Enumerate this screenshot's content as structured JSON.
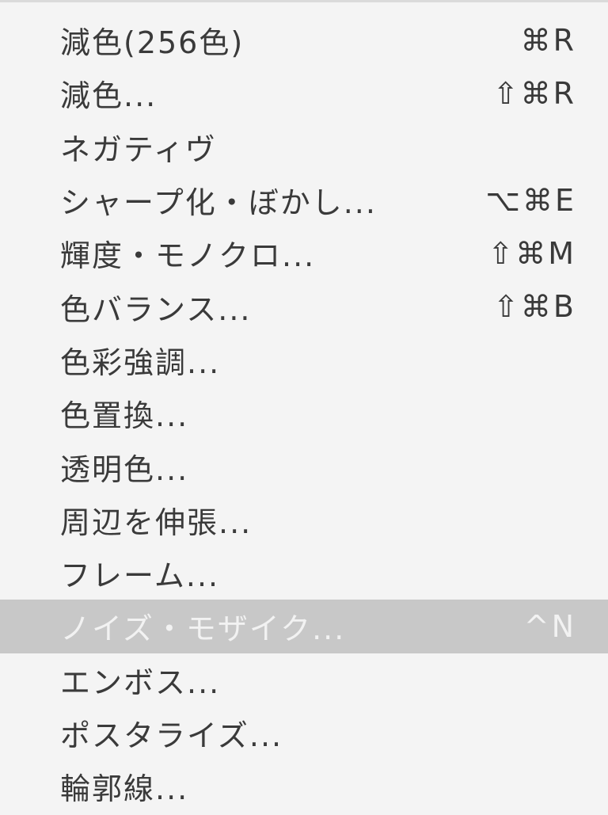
{
  "menu": {
    "items": [
      {
        "label": "減色(256色)",
        "shortcut": "⌘R",
        "highlighted": false
      },
      {
        "label": "減色...",
        "shortcut": "⇧⌘R",
        "highlighted": false
      },
      {
        "label": "ネガティヴ",
        "shortcut": "",
        "highlighted": false
      },
      {
        "label": "シャープ化・ぼかし...",
        "shortcut": "⌥⌘E",
        "highlighted": false
      },
      {
        "label": "輝度・モノクロ...",
        "shortcut": "⇧⌘M",
        "highlighted": false
      },
      {
        "label": "色バランス...",
        "shortcut": "⇧⌘B",
        "highlighted": false
      },
      {
        "label": "色彩強調...",
        "shortcut": "",
        "highlighted": false
      },
      {
        "label": "色置換...",
        "shortcut": "",
        "highlighted": false
      },
      {
        "label": "透明色...",
        "shortcut": "",
        "highlighted": false
      },
      {
        "label": "周辺を伸張...",
        "shortcut": "",
        "highlighted": false
      },
      {
        "label": "フレーム...",
        "shortcut": "",
        "highlighted": false
      },
      {
        "label": "ノイズ・モザイク...",
        "shortcut": "^N",
        "highlighted": true
      },
      {
        "label": "エンボス...",
        "shortcut": "",
        "highlighted": false
      },
      {
        "label": "ポスタライズ...",
        "shortcut": "",
        "highlighted": false
      },
      {
        "label": "輪郭線...",
        "shortcut": "",
        "highlighted": false
      }
    ]
  },
  "colors": {
    "menu_background": "#f4f4f4",
    "text": "#3a3a3a",
    "highlight_background": "#c8c8c8",
    "highlight_text": "#f2f2f2"
  }
}
